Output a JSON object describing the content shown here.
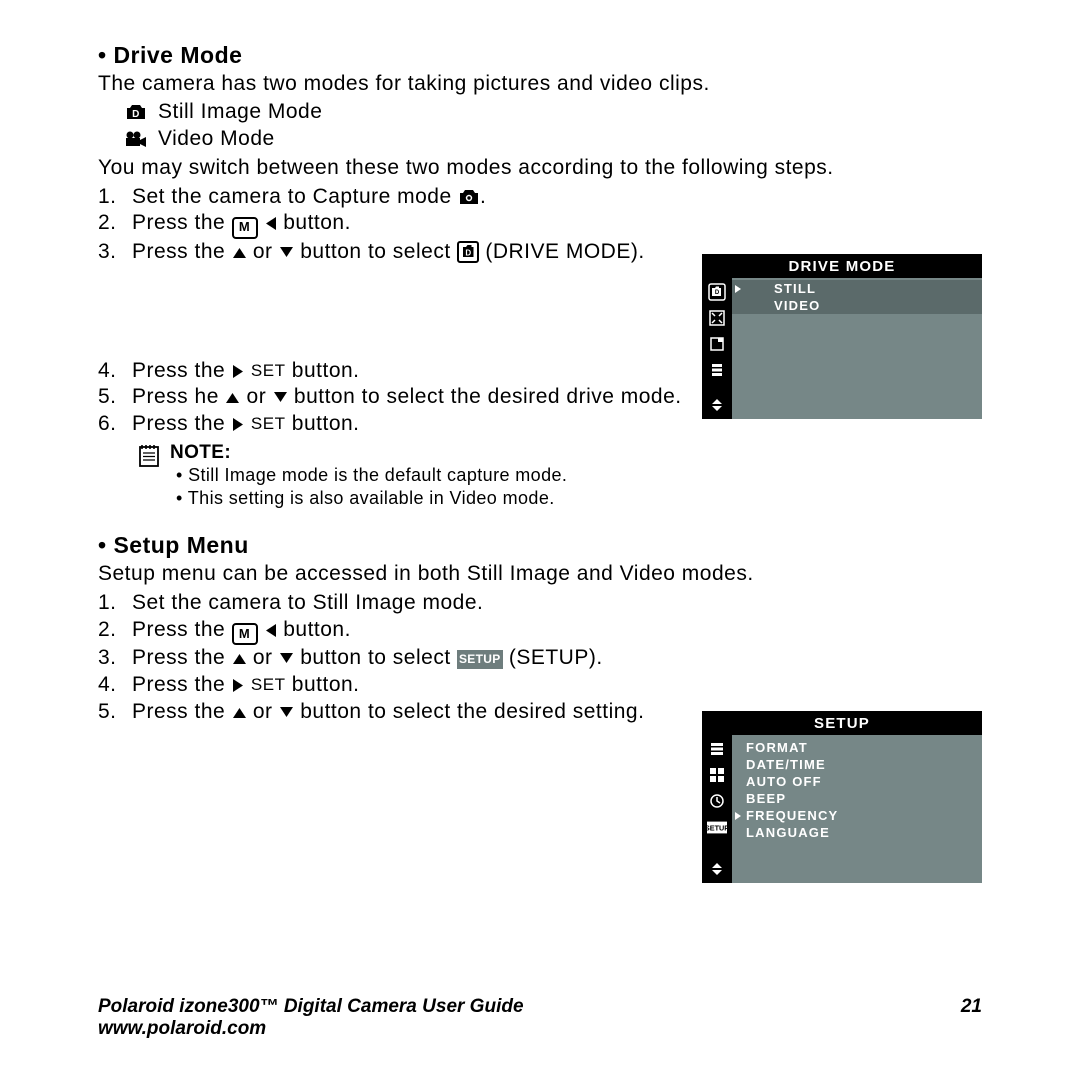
{
  "sectionA": {
    "heading": "•  Drive Mode",
    "intro": "The camera has two modes for taking pictures and video clips.",
    "modes": [
      {
        "label": "Still Image Mode"
      },
      {
        "label": "Video Mode"
      }
    ],
    "switchIntro": "You  may  switch  between  these  two  modes  according  to  the  following steps.",
    "steps123": {
      "s1_pre": "Set the camera to Capture mode ",
      "s1_post": ".",
      "s2_pre": "Press the ",
      "s2_m": "M",
      "s2_post": " button.",
      "s3_pre": "Press the ",
      "s3_mid": " or ",
      "s3_mid2": " button to select ",
      "s3_post": " (DRIVE MODE)."
    },
    "steps456": {
      "s4_pre": "Press the ",
      "s4_set": "SET",
      "s4_post": " button.",
      "s5_pre": "Press he ",
      "s5_mid": " or ",
      "s5_post": " button to select the desired drive mode.",
      "s6_pre": "Press the ",
      "s6_set": "SET",
      "s6_post": " button."
    },
    "note": {
      "label": "NOTE:",
      "b1": "• Still Image mode is the default capture mode.",
      "b2": "• This setting is also available in Video mode."
    }
  },
  "drivePanel": {
    "header": "DRIVE MODE",
    "rows": [
      {
        "label": "STILL",
        "selected": true
      },
      {
        "label": "VIDEO",
        "selected": false
      }
    ]
  },
  "sectionB": {
    "heading": "•  Setup Menu",
    "intro": "Setup menu can be accessed in both Still Image and Video modes.",
    "steps": {
      "s1": "Set the camera to Still Image mode.",
      "s2_pre": "Press the ",
      "s2_m": "M",
      "s2_post": " button.",
      "s3_pre": "Press the ",
      "s3_mid": " or ",
      "s3_mid2": " button to select ",
      "s3_chip": "SETUP",
      "s3_post": " (SETUP).",
      "s4_pre": "Press the ",
      "s4_set": "SET",
      "s4_post": " button.",
      "s5_pre": "Press the ",
      "s5_mid": " or ",
      "s5_post": " button to select the desired setting."
    }
  },
  "setupPanel": {
    "header": "SETUP",
    "rows": [
      {
        "label": "FORMAT"
      },
      {
        "label": "DATE/TIME"
      },
      {
        "label": "AUTO OFF"
      },
      {
        "label": "BEEP"
      },
      {
        "label": "FREQUENCY",
        "arrow": true
      },
      {
        "label": "LANGUAGE"
      }
    ]
  },
  "footer": {
    "title": "Polaroid izone300™ Digital Camera User Guide",
    "url": "www.polaroid.com",
    "page": "21"
  }
}
